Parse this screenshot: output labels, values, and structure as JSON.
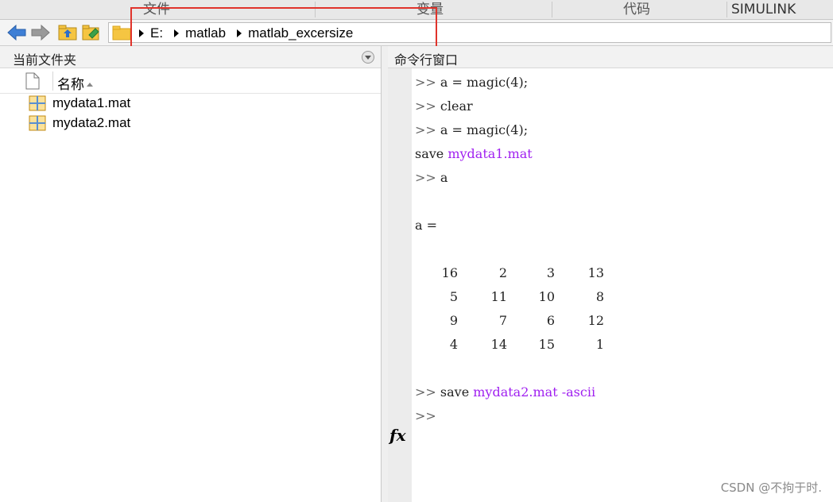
{
  "ribbon": {
    "sections": [
      "文件",
      "变量",
      "代码",
      "SIMULINK"
    ]
  },
  "toolbar": {
    "icons": [
      "back-arrow-icon",
      "forward-arrow-icon",
      "up-folder-icon",
      "browse-folder-icon",
      "folder-icon"
    ],
    "breadcrumbs": [
      "E:",
      "matlab",
      "matlab_excersize"
    ]
  },
  "current_folder": {
    "title": "当前文件夹",
    "column_name": "名称",
    "files": [
      "mydata1.mat",
      "mydata2.mat"
    ]
  },
  "command_window": {
    "title": "命令行窗口",
    "prompt": ">>",
    "lines": {
      "l1": "a = magic(4);",
      "l2": "clear",
      "l3": "a = magic(4);",
      "l4_cmd": "save ",
      "l4_arg": "mydata1.mat",
      "l5": "a",
      "l6": "a =",
      "l7_cmd": "save ",
      "l7_arg": "mydata2.mat -ascii"
    },
    "matrix": [
      [
        16,
        2,
        3,
        13
      ],
      [
        5,
        11,
        10,
        8
      ],
      [
        9,
        7,
        6,
        12
      ],
      [
        4,
        14,
        15,
        1
      ]
    ],
    "fx_label": "fx"
  },
  "watermark": "CSDN @不拘于时.",
  "colors": {
    "highlight_box": "#e0332b",
    "string_purple": "#a020f0",
    "folder_yellow": "#f5c542"
  }
}
